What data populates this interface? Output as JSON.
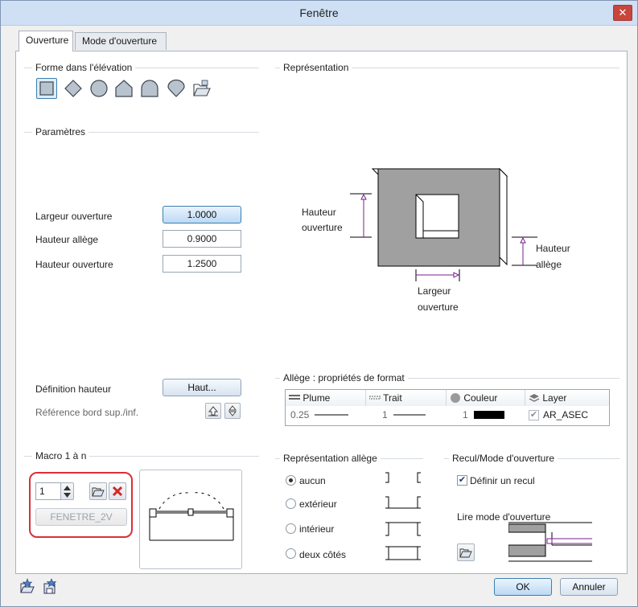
{
  "window": {
    "title": "Fenêtre",
    "close_glyph": "✕"
  },
  "tabs": [
    {
      "label": "Ouverture",
      "active": true
    },
    {
      "label": "Mode d'ouverture",
      "active": false
    }
  ],
  "forme": {
    "title": "Forme dans l'élévation",
    "shapes": [
      "rectangle-icon",
      "diamond-icon",
      "circle-icon",
      "pentagon-icon",
      "arch-icon",
      "teardrop-icon",
      "open-folder-icon"
    ]
  },
  "parametres": {
    "title": "Paramètres",
    "largeur_label": "Largeur ouverture",
    "largeur_value": "1.0000",
    "hauteur_allege_label": "Hauteur allège",
    "hauteur_allege_value": "0.9000",
    "hauteur_ouverture_label": "Hauteur ouverture",
    "hauteur_ouverture_value": "1.2500",
    "definition_label": "Définition hauteur",
    "definition_button": "Haut...",
    "reference_label": "Référence bord sup./inf."
  },
  "representation": {
    "title": "Représentation",
    "hauteur_ouverture_l1": "Hauteur",
    "hauteur_ouverture_l2": "ouverture",
    "hauteur_allege_l1": "Hauteur",
    "hauteur_allege_l2": "allège",
    "largeur_l1": "Largeur",
    "largeur_l2": "ouverture"
  },
  "allege_format": {
    "title": "Allège : propriétés de format",
    "headers": [
      "Plume",
      "Trait",
      "Couleur",
      "Layer"
    ],
    "row": {
      "plume": "0.25",
      "trait": "1",
      "couleur": "1",
      "layer": "AR_ASEC",
      "layer_check": "✔"
    }
  },
  "macro": {
    "title": "Macro 1 à n",
    "spin_value": "1",
    "macro_name": "FENETRE_2V"
  },
  "repr_allege": {
    "title": "Représentation allège",
    "options": [
      {
        "label": "aucun",
        "checked": true
      },
      {
        "label": "extérieur",
        "checked": false
      },
      {
        "label": "intérieur",
        "checked": false
      },
      {
        "label": "deux côtés",
        "checked": false
      }
    ]
  },
  "recul": {
    "title": "Recul/Mode d'ouverture",
    "checkbox_label": "Définir un recul",
    "checkbox_mark": "✔",
    "lire_label": "Lire mode d'ouverture"
  },
  "footer": {
    "ok": "OK",
    "cancel": "Annuler"
  },
  "colors": {
    "accent": "#3c7fb1",
    "highlight": "#d93037",
    "dimension": "#7a1f8f"
  }
}
